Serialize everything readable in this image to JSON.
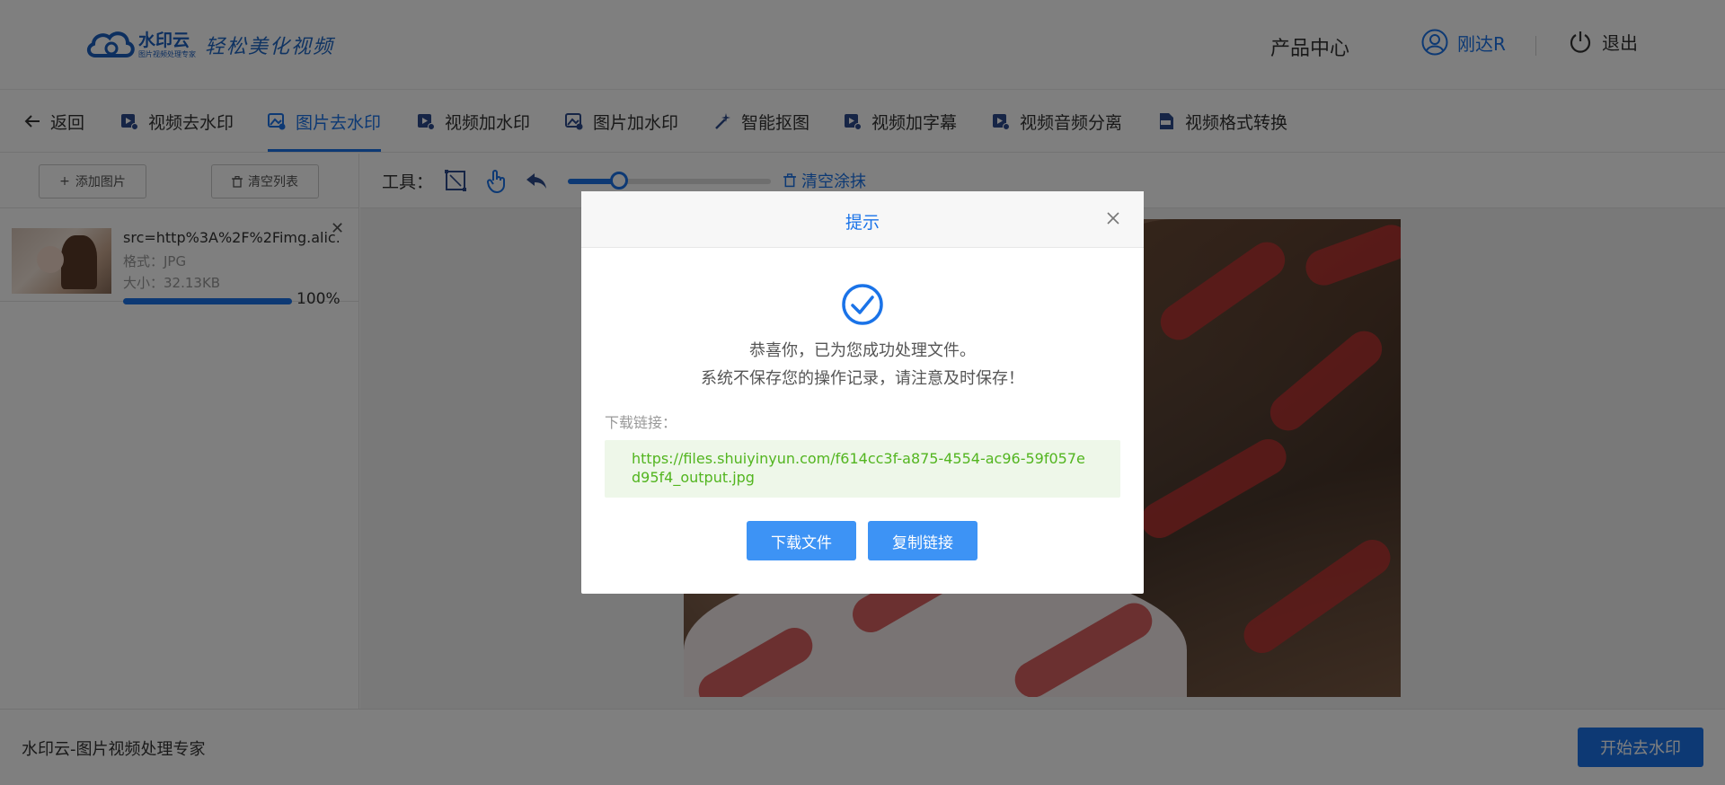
{
  "header": {
    "logo_name": "水印云",
    "logo_sub": "图片视频处理专家",
    "slogan": "轻松美化视频",
    "product_center": "产品中心",
    "user_name": "刚达R",
    "logout": "退出"
  },
  "nav": {
    "back": "返回",
    "items": [
      {
        "label": "视频去水印",
        "icon": "video-icon"
      },
      {
        "label": "图片去水印",
        "icon": "image-icon",
        "active": true
      },
      {
        "label": "视频加水印",
        "icon": "video-icon"
      },
      {
        "label": "图片加水印",
        "icon": "image-icon"
      },
      {
        "label": "智能抠图",
        "icon": "magic-wand-icon"
      },
      {
        "label": "视频加字幕",
        "icon": "video-icon"
      },
      {
        "label": "视频音频分离",
        "icon": "video-icon"
      },
      {
        "label": "视频格式转换",
        "icon": "mp4-file-icon"
      }
    ]
  },
  "left_panel": {
    "add_image": "添加图片",
    "clear_list": "清空列表",
    "file": {
      "name": "src=http%3A%2F%2Fimg.alic...",
      "format": "格式：JPG",
      "size": "大小：32.13KB",
      "progress_text": "100%",
      "progress": 1.0
    }
  },
  "tools": {
    "label": "工具：",
    "clear_erase": "清空涂抹",
    "brush_size_fraction": 0.25
  },
  "footer": {
    "brand": "水印云-图片视频处理专家",
    "start_button": "开始去水印"
  },
  "modal": {
    "title": "提示",
    "line1": "恭喜你，已为您成功处理文件。",
    "line2": "系统不保存您的操作记录，请注意及时保存！",
    "download_label": "下载链接：",
    "download_url": "https://files.shuiyinyun.com/f614cc3f-a875-4554-ac96-59f057ed95f4_output.jpg",
    "download_button": "下载文件",
    "copy_button": "复制链接"
  },
  "colors": {
    "accent": "#1a73e8",
    "success_text": "#52b51f",
    "success_bg": "#eef7e9",
    "modal_button": "#3d93f5"
  }
}
